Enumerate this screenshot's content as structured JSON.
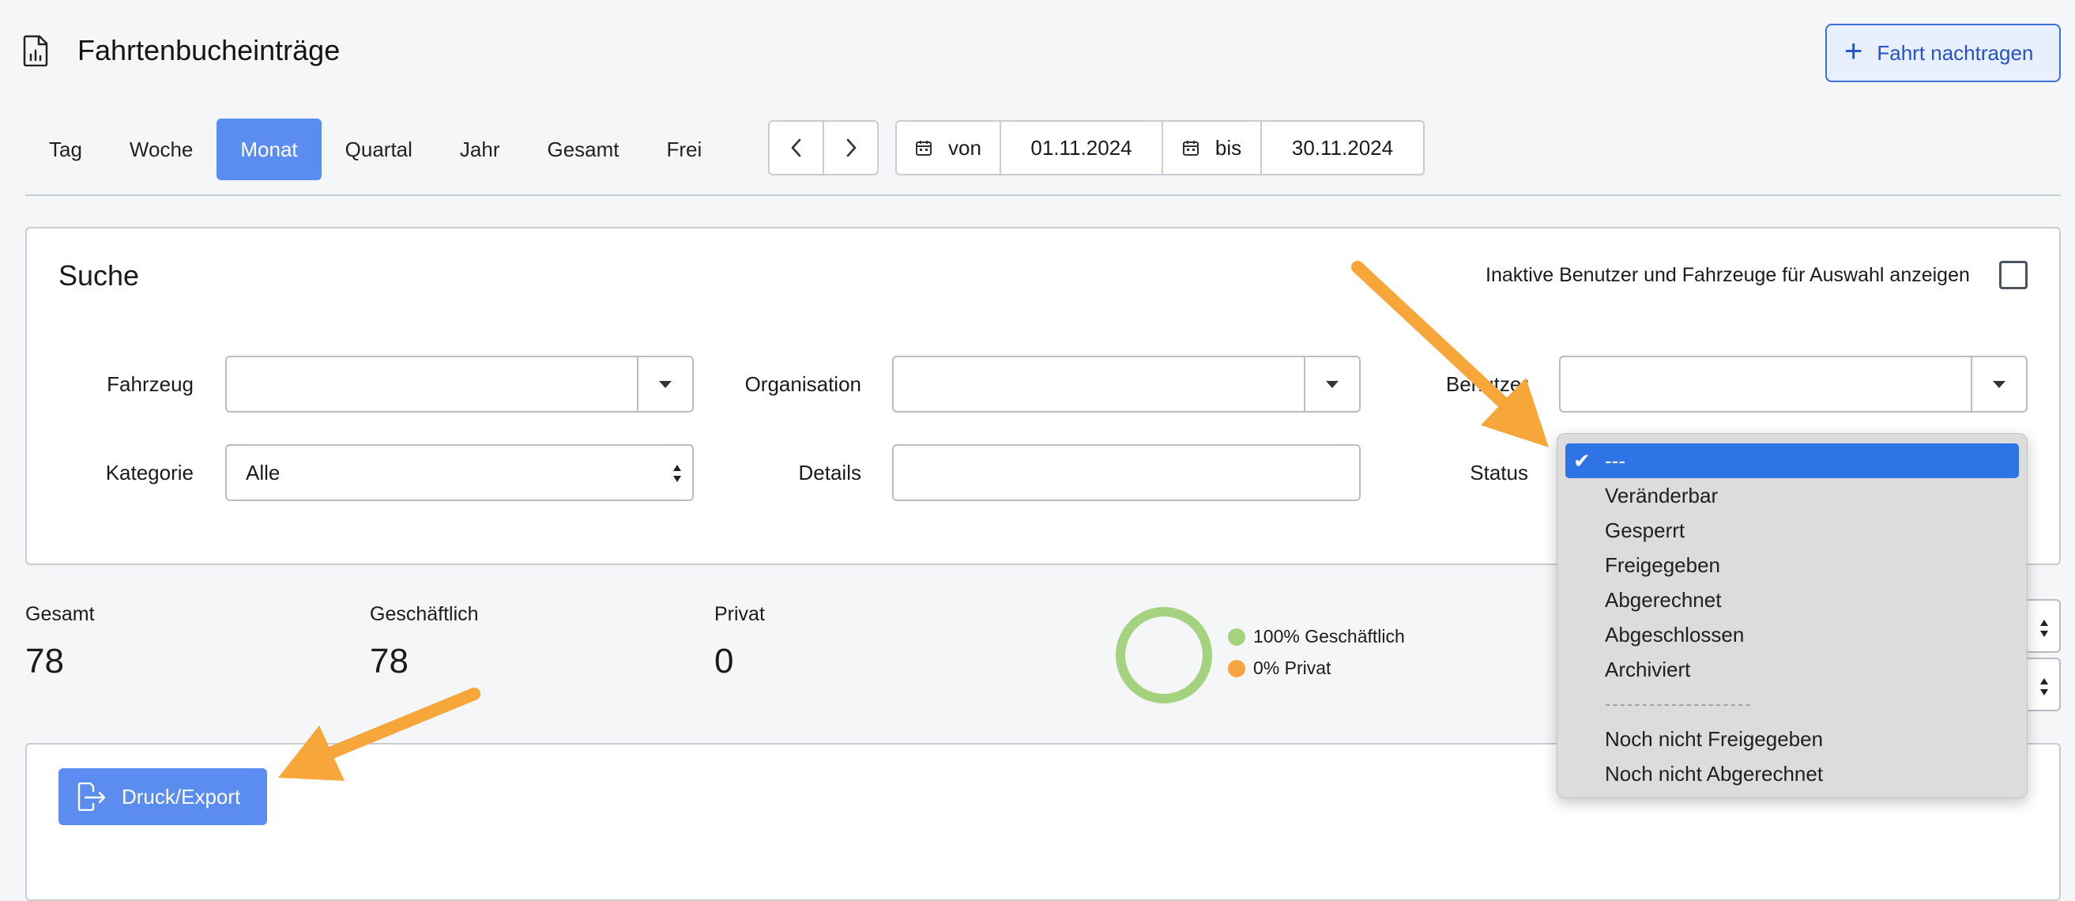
{
  "header": {
    "title": "Fahrtenbucheinträge",
    "add_button": "Fahrt nachtragen"
  },
  "periods": {
    "items": [
      "Tag",
      "Woche",
      "Monat",
      "Quartal",
      "Jahr",
      "Gesamt",
      "Frei"
    ],
    "active": "Monat"
  },
  "daterange": {
    "from_label": "von",
    "from": "01.11.2024",
    "to_label": "bis",
    "to": "30.11.2024"
  },
  "search": {
    "title": "Suche",
    "inactive_label": "Inaktive Benutzer und Fahrzeuge für Auswahl anzeigen",
    "labels": {
      "vehicle": "Fahrzeug",
      "organisation": "Organisation",
      "user": "Benutzer",
      "category": "Kategorie",
      "details": "Details",
      "status": "Status"
    },
    "category_value": "Alle",
    "details_value": ""
  },
  "stats": {
    "total_label": "Gesamt",
    "total": "78",
    "business_label": "Geschäftlich",
    "business": "78",
    "private_label": "Privat",
    "private": "0",
    "legend_business": "100% Geschäftlich",
    "legend_private": "0% Privat",
    "business_fraction": 1.0,
    "colors": {
      "business": "#a5d27e",
      "private": "#f6a63c"
    }
  },
  "export": {
    "label": "Druck/Export"
  },
  "status_dropdown": {
    "options": [
      "---",
      "Veränderbar",
      "Gesperrt",
      "Freigegeben",
      "Abgerechnet",
      "Abgeschlossen",
      "Archiviert"
    ],
    "separator": "--------------------",
    "extra_options": [
      "Noch nicht Freigegeben",
      "Noch nicht Abgerechnet"
    ],
    "selected": "---"
  },
  "colors": {
    "accent": "#5b8cf0",
    "annotation_arrow": "#f7a63a",
    "selected_option": "#2e74e6"
  }
}
